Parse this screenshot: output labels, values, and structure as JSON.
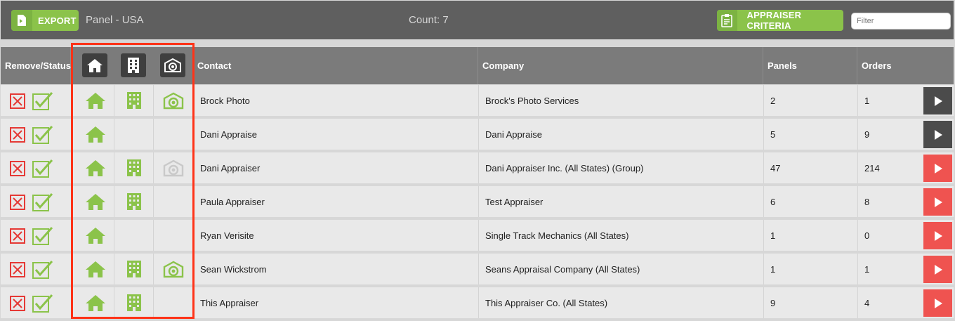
{
  "toolbar": {
    "export_label": "EXPORT",
    "panel_title": "Panel - USA",
    "count_text": "Count: 7",
    "criteria_label": "APPRAISER CRITERIA",
    "filter_placeholder": "Filter"
  },
  "columns": {
    "remove_status": "Remove/Status",
    "contact": "Contact",
    "company": "Company",
    "panels": "Panels",
    "orders": "Orders"
  },
  "header_icons": [
    "house-icon",
    "building-icon",
    "camera-icon"
  ],
  "colors": {
    "accent_green": "#8bc34a",
    "remove_red": "#e53935",
    "go_dark": "#4b4b4b",
    "go_red": "#ef5350",
    "disabled_icon": "#c9c9c9",
    "highlight": "#ff3318"
  },
  "rows": [
    {
      "contact": "Brock Photo",
      "company": "Brock's Photo Services",
      "panels": "2",
      "orders": "1",
      "house": "active",
      "building": "active",
      "camera": "active",
      "go_style": "dark"
    },
    {
      "contact": "Dani Appraise",
      "company": "Dani Appraise",
      "panels": "5",
      "orders": "9",
      "house": "active",
      "building": "none",
      "camera": "none",
      "go_style": "dark"
    },
    {
      "contact": "Dani Appraiser",
      "company": "Dani Appraiser Inc. (All States) (Group)",
      "panels": "47",
      "orders": "214",
      "house": "active",
      "building": "active",
      "camera": "disabled",
      "go_style": "red"
    },
    {
      "contact": "Paula Appraiser",
      "company": "Test Appraiser",
      "panels": "6",
      "orders": "8",
      "house": "active",
      "building": "active",
      "camera": "none",
      "go_style": "red"
    },
    {
      "contact": "Ryan Verisite",
      "company": "Single Track Mechanics (All States)",
      "panels": "1",
      "orders": "0",
      "house": "active",
      "building": "none",
      "camera": "none",
      "go_style": "red"
    },
    {
      "contact": "Sean Wickstrom",
      "company": "Seans Appraisal Company (All States)",
      "panels": "1",
      "orders": "1",
      "house": "active",
      "building": "active",
      "camera": "active",
      "go_style": "red"
    },
    {
      "contact": "This Appraiser",
      "company": "This Appraiser Co. (All States)",
      "panels": "9",
      "orders": "4",
      "house": "active",
      "building": "active",
      "camera": "none",
      "go_style": "red"
    }
  ]
}
